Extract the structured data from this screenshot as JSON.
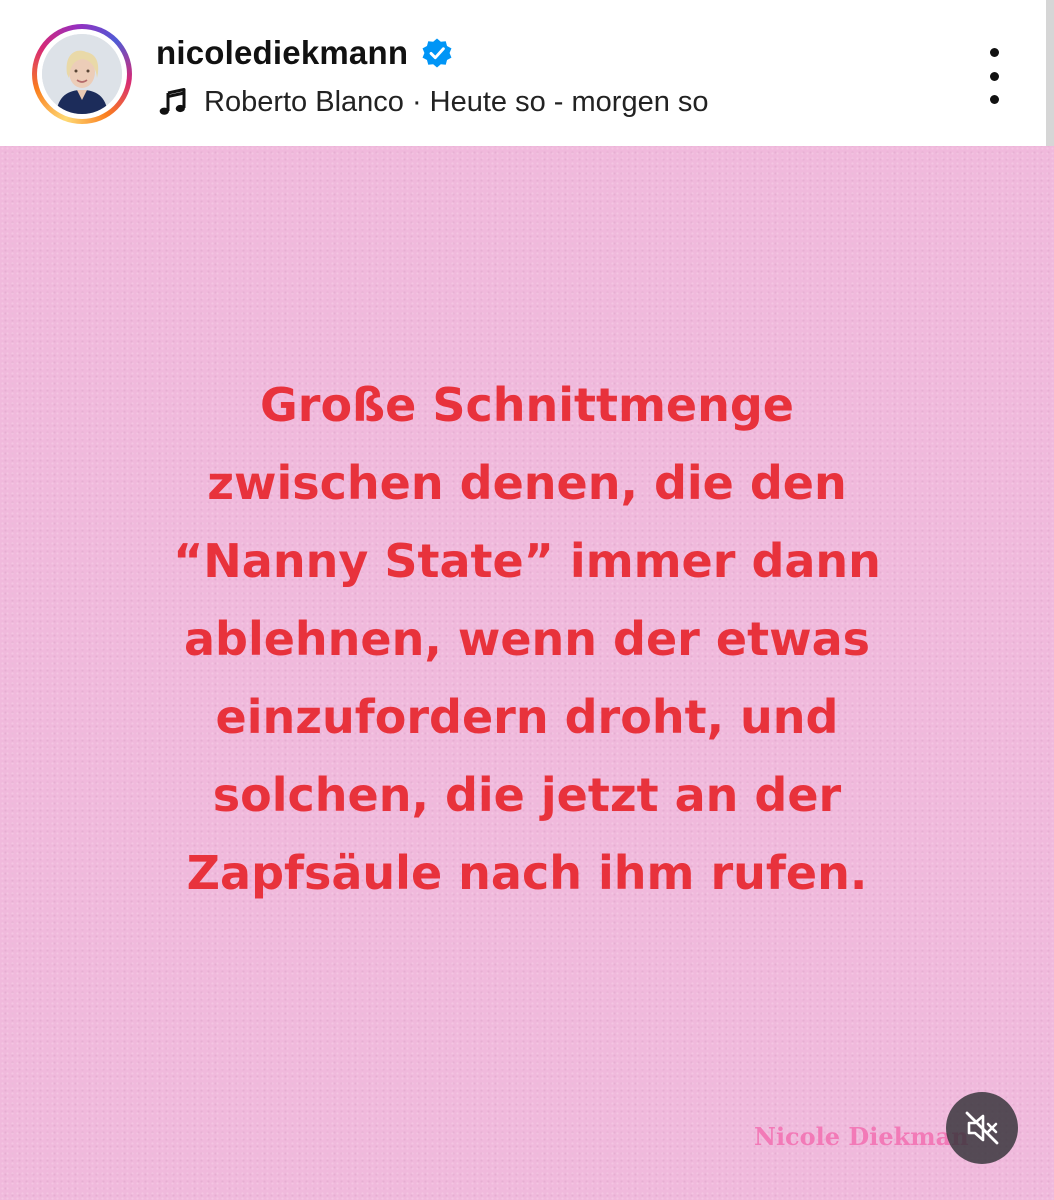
{
  "post_header": {
    "username": "nicolediekmann",
    "verified_icon": "verified-badge-icon",
    "music_icon": "music-note-icon",
    "music_label": "Roberto Blanco · Heute so - morgen so",
    "more_icon": "more-vertical-icon",
    "ring_colors": [
      "#feda75",
      "#fa7e1e",
      "#d62976",
      "#962fbf",
      "#4f5bd5"
    ]
  },
  "post": {
    "background_color": "#f0b9dc",
    "text_color": "#e8323c",
    "quote_lines": [
      "Große Schnittmenge",
      "zwischen denen, die den",
      "“Nanny State” immer dann",
      "ablehnen, wenn der etwas",
      "einzufordern droht, und",
      "solchen, die jetzt an der",
      "Zapfsäule nach ihm rufen."
    ],
    "watermark": "Nicole Diekman",
    "watermark_color": "#f27ab7",
    "mute_icon": "speaker-muted-icon"
  }
}
